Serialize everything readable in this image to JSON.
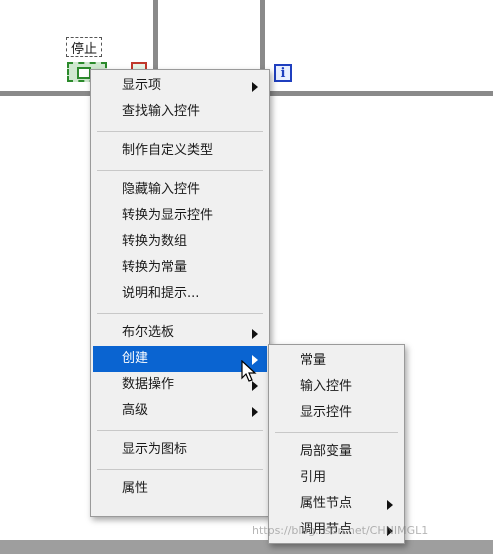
{
  "diagram": {
    "stop_label": "停止",
    "info_icon_text": "i"
  },
  "context_menu": {
    "items": [
      {
        "label": "显示项"
      },
      {
        "label": "查找输入控件"
      },
      {
        "label": "制作自定义类型"
      },
      {
        "label": "隐藏输入控件"
      },
      {
        "label": "转换为显示控件"
      },
      {
        "label": "转换为数组"
      },
      {
        "label": "转换为常量"
      },
      {
        "label": "说明和提示..."
      },
      {
        "label": "布尔选板"
      },
      {
        "label": "创建"
      },
      {
        "label": "数据操作"
      },
      {
        "label": "高级"
      },
      {
        "label": "显示为图标"
      },
      {
        "label": "属性"
      }
    ]
  },
  "submenu": {
    "items": [
      {
        "label": "常量"
      },
      {
        "label": "输入控件"
      },
      {
        "label": "显示控件"
      },
      {
        "label": "局部变量"
      },
      {
        "label": "引用"
      },
      {
        "label": "属性节点"
      },
      {
        "label": "调用节点"
      }
    ]
  },
  "watermark": "https://blog.csdn.net/CHNIMGL1"
}
